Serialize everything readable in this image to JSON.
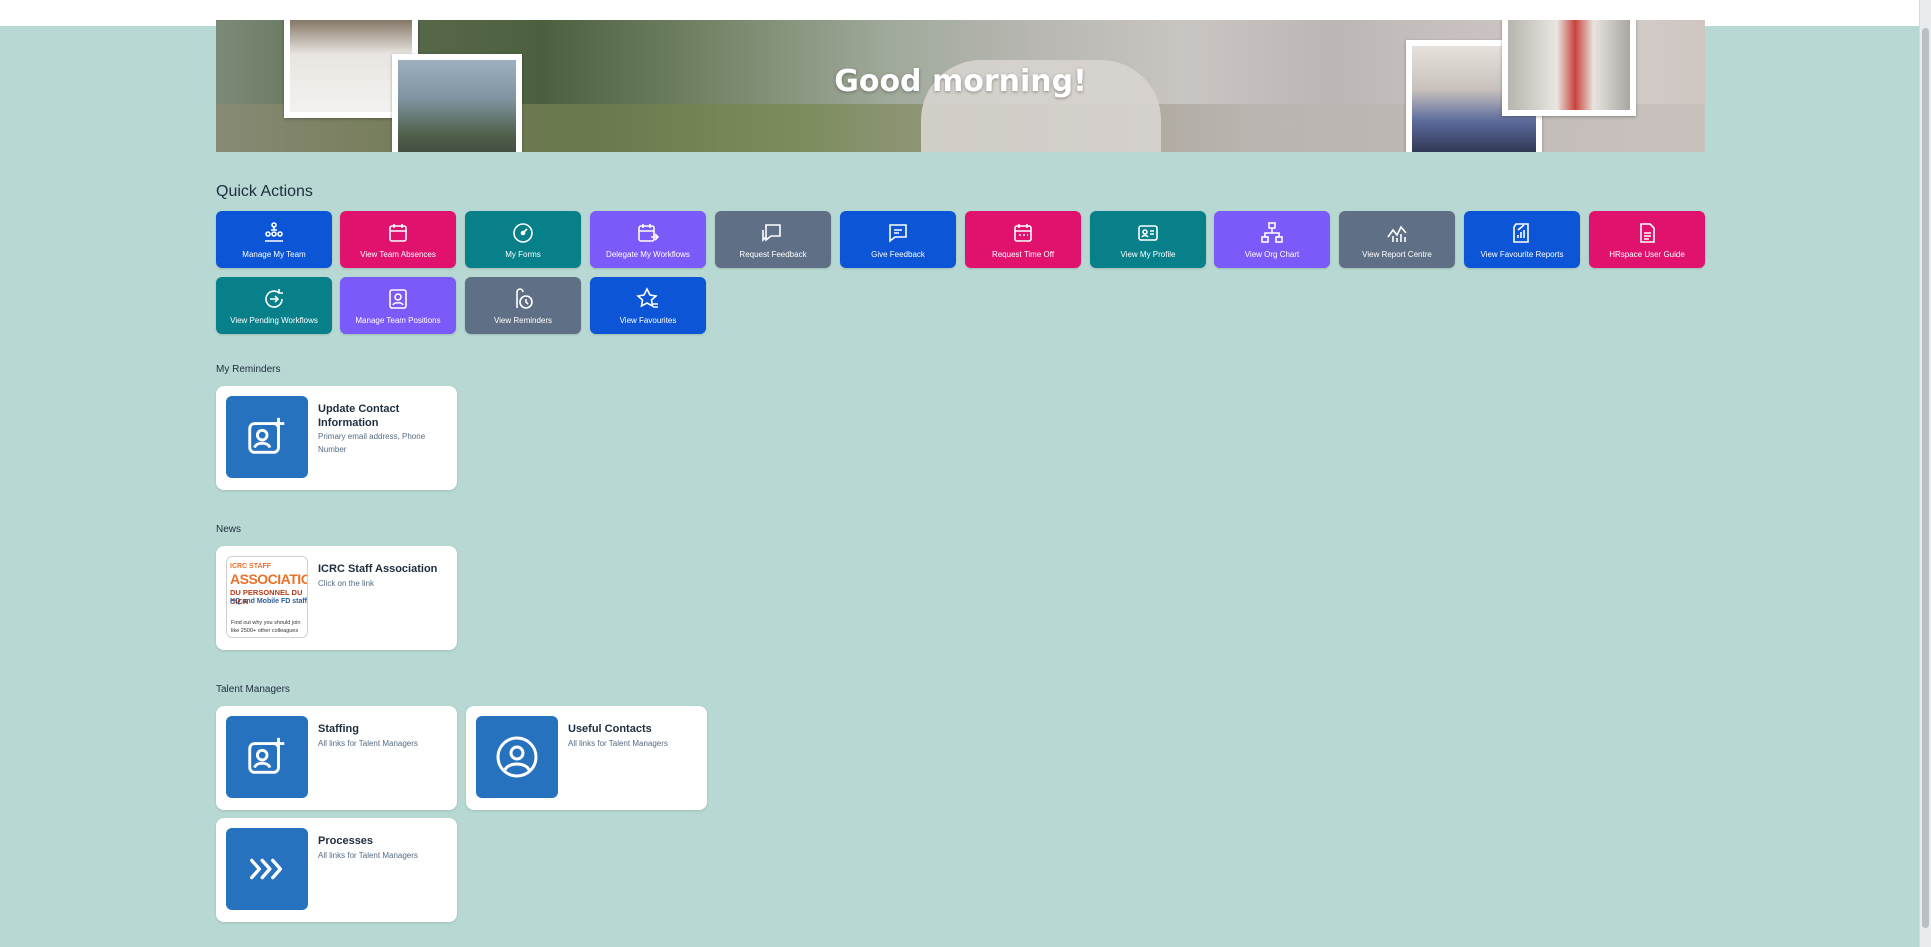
{
  "banner": {
    "greeting": "Good morning!"
  },
  "quick_actions": {
    "title": "Quick Actions",
    "items": [
      {
        "label": "Manage My Team",
        "icon": "team-hierarchy-icon",
        "color": "#0b55d6"
      },
      {
        "label": "View Team Absences",
        "icon": "calendar-icon",
        "color": "#e0126e"
      },
      {
        "label": "My Forms",
        "icon": "gauge-icon",
        "color": "#07808a"
      },
      {
        "label": "Delegate My Workflows",
        "icon": "calendar-forward-icon",
        "color": "#7a5af8"
      },
      {
        "label": "Request Feedback",
        "icon": "chat-request-icon",
        "color": "#5f7086"
      },
      {
        "label": "Give Feedback",
        "icon": "chat-icon",
        "color": "#0b55d6"
      },
      {
        "label": "Request Time Off",
        "icon": "calendar-icon",
        "color": "#e0126e"
      },
      {
        "label": "View My Profile",
        "icon": "id-card-icon",
        "color": "#07808a"
      },
      {
        "label": "View Org Chart",
        "icon": "org-chart-icon",
        "color": "#7a5af8"
      },
      {
        "label": "View Report Centre",
        "icon": "line-chart-icon",
        "color": "#5f7086"
      },
      {
        "label": "View Favourite Reports",
        "icon": "report-icon",
        "color": "#0b55d6"
      },
      {
        "label": "HRspace User Guide",
        "icon": "document-icon",
        "color": "#e0126e"
      },
      {
        "label": "View Pending Workflows",
        "icon": "refresh-pending-icon",
        "color": "#07808a"
      },
      {
        "label": "Manage Team Positions",
        "icon": "person-card-icon",
        "color": "#7a5af8"
      },
      {
        "label": "View Reminders",
        "icon": "reminder-clock-icon",
        "color": "#5f7086"
      },
      {
        "label": "View Favourites",
        "icon": "star-list-icon",
        "color": "#0b55d6"
      }
    ]
  },
  "reminders": {
    "title": "My Reminders",
    "items": [
      {
        "title": "Update Contact Information",
        "subtitle": "Primary email address, Phone Number",
        "icon": "contact-add-icon"
      }
    ]
  },
  "news": {
    "title": "News",
    "items": [
      {
        "title": "ICRC Staff Association",
        "subtitle": "Click on the link",
        "image_text": {
          "line1": "ICRC STAFF",
          "line2": "ASSOCIATION",
          "line3": "DU PERSONNEL DU CICR",
          "line4": "HQ and Mobile FD staff",
          "line5": "Find out why you should join like 2500+ other colleagues"
        }
      }
    ]
  },
  "talent_managers": {
    "title": "Talent Managers",
    "items": [
      {
        "title": "Staffing",
        "subtitle": "All links for Talent Managers",
        "icon": "contact-add-icon"
      },
      {
        "title": "Useful Contacts",
        "subtitle": "All links for Talent Managers",
        "icon": "user-circle-icon"
      },
      {
        "title": "Processes",
        "subtitle": "All links for Talent Managers",
        "icon": "chevrons-right-icon"
      }
    ]
  }
}
